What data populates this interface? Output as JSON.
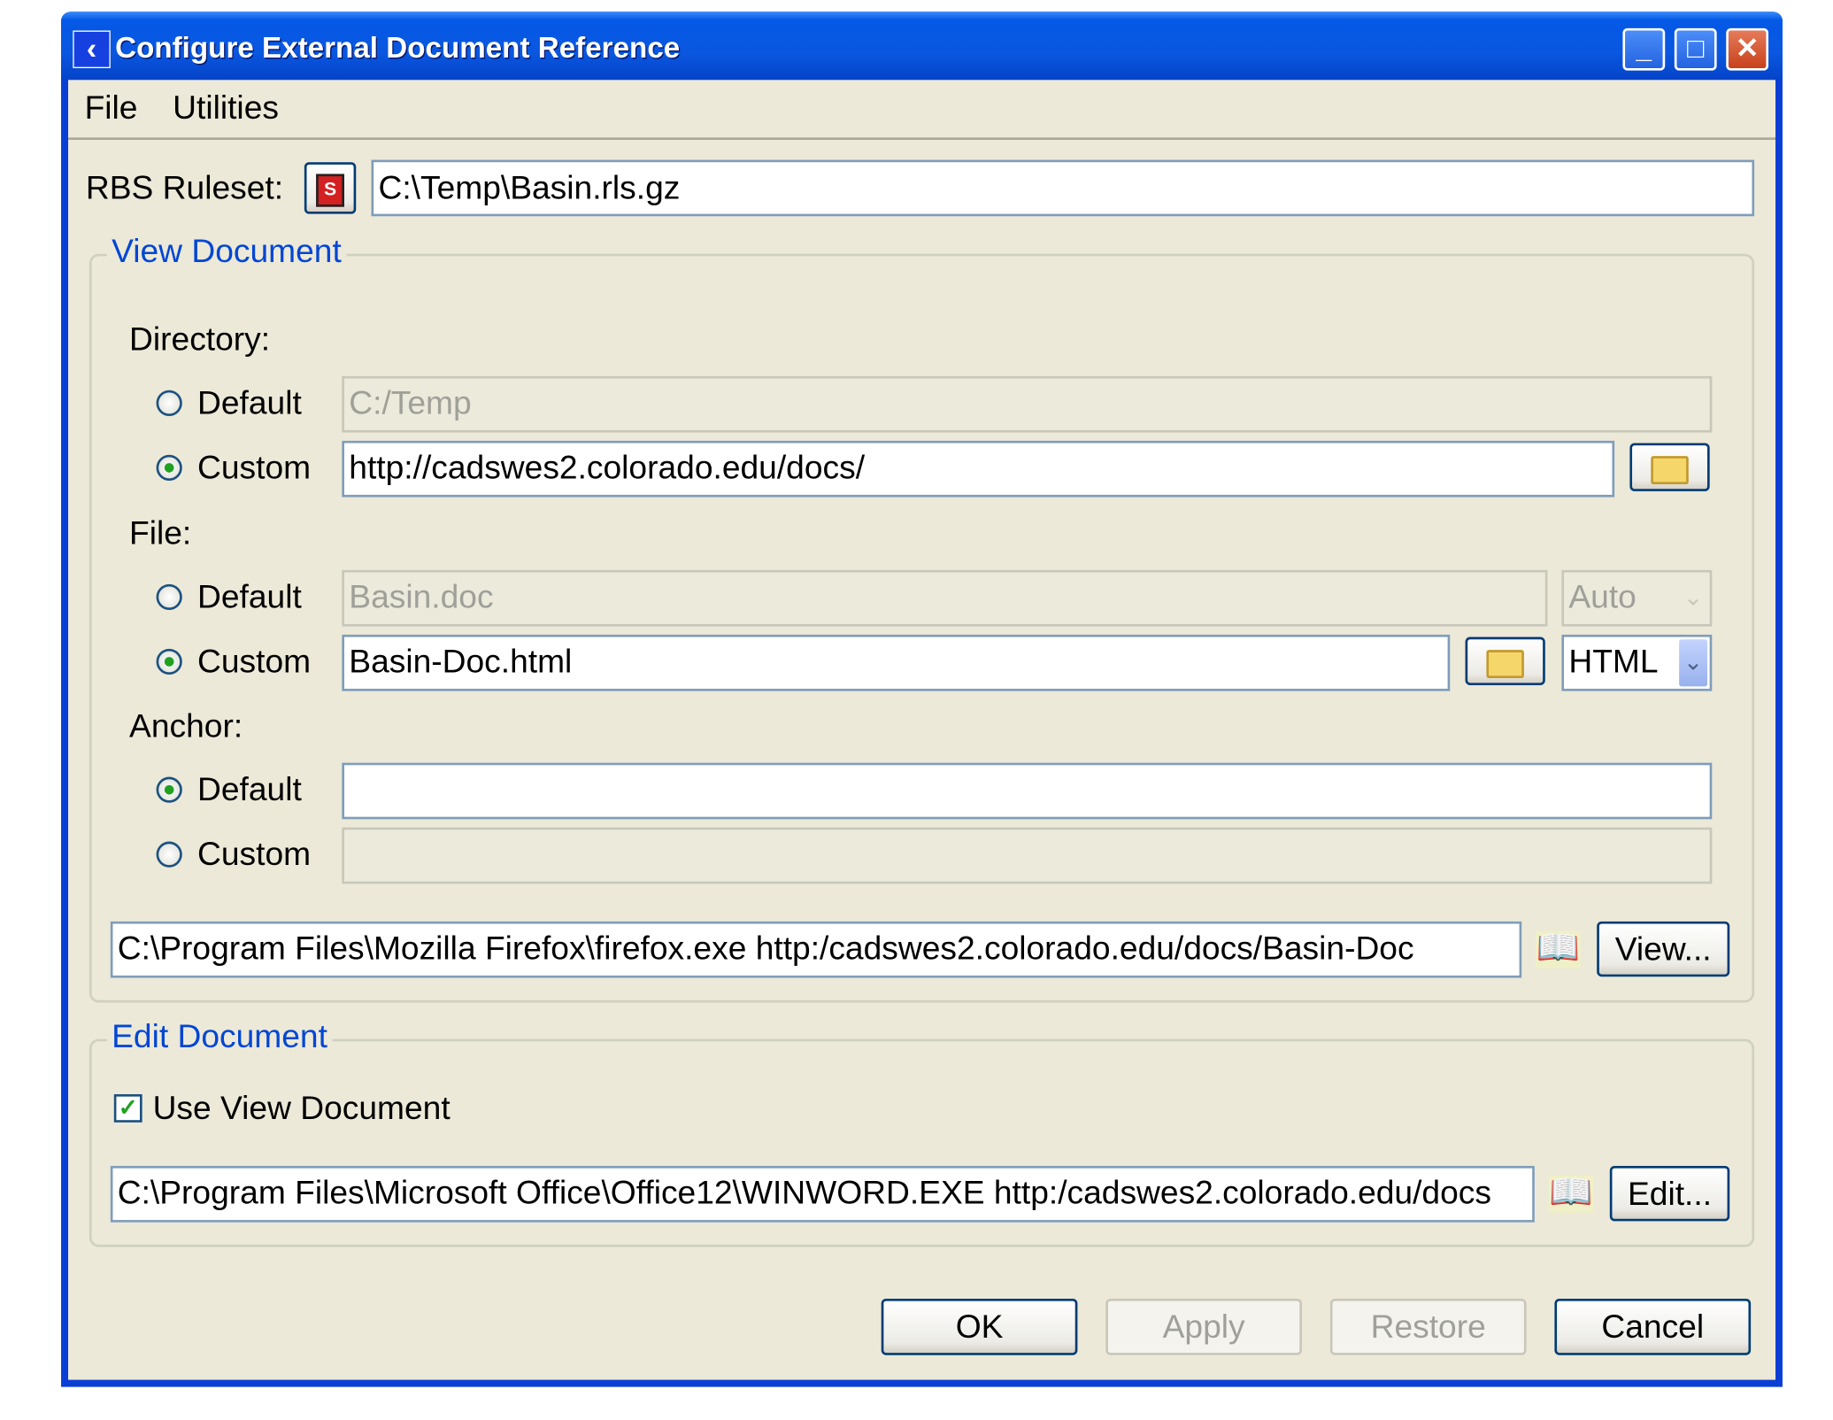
{
  "window": {
    "title": "Configure External Document Reference"
  },
  "menu": {
    "file": "File",
    "utilities": "Utilities"
  },
  "ruleset": {
    "label": "RBS Ruleset:",
    "value": "C:\\Temp\\Basin.rls.gz"
  },
  "view_document": {
    "title": "View Document",
    "directory": {
      "label": "Directory:",
      "default_label": "Default",
      "default_value": "C:/Temp",
      "custom_label": "Custom",
      "custom_value": "http://cadswes2.colorado.edu/docs/",
      "selected": "custom"
    },
    "file": {
      "label": "File:",
      "default_label": "Default",
      "default_value": "Basin.doc",
      "default_type": "Auto",
      "custom_label": "Custom",
      "custom_value": "Basin-Doc.html",
      "custom_type": "HTML",
      "selected": "custom"
    },
    "anchor": {
      "label": "Anchor:",
      "default_label": "Default",
      "default_value": "",
      "custom_label": "Custom",
      "custom_value": "",
      "selected": "default"
    },
    "command": "C:\\Program Files\\Mozilla Firefox\\firefox.exe http:/cadswes2.colorado.edu/docs/Basin-Doc",
    "view_button": "View..."
  },
  "edit_document": {
    "title": "Edit Document",
    "use_view_label": "Use View Document",
    "use_view_checked": true,
    "command": "C:\\Program Files\\Microsoft Office\\Office12\\WINWORD.EXE http:/cadswes2.colorado.edu/docs",
    "edit_button": "Edit..."
  },
  "buttons": {
    "ok": "OK",
    "apply": "Apply",
    "restore": "Restore",
    "cancel": "Cancel"
  }
}
